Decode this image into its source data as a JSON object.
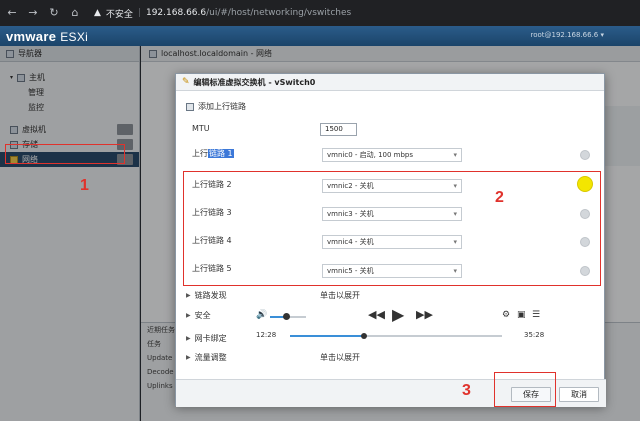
{
  "browser": {
    "security_label": "不安全",
    "host": "192.168.66.6",
    "path": "/ui/#/host/networking/vswitches"
  },
  "header": {
    "logo_brand": "vmware",
    "logo_product": "ESXi",
    "user": "root@192.168.66.6 ▾"
  },
  "sidebar": {
    "title": "导航器",
    "items": [
      {
        "label": "主机",
        "level": 0
      },
      {
        "label": "管理",
        "level": 1
      },
      {
        "label": "监控",
        "level": 1
      },
      {
        "label": "虚拟机",
        "level": 0
      },
      {
        "label": "存储",
        "level": 0
      },
      {
        "label": "网络",
        "level": 0,
        "selected": true
      }
    ]
  },
  "content": {
    "title": "localhost.localdomain - 网络",
    "bottom_rows": [
      "近期任务",
      "任务",
      "Update",
      "Decode",
      "Uplinks"
    ]
  },
  "modal": {
    "title": "编辑标准虚拟交换机 - vSwitch0",
    "add_uplink": "添加上行链路",
    "mtu_label": "MTU",
    "mtu_value": "1500",
    "uplinks": [
      {
        "label_prefix": "上行",
        "label_highlight": "链路 1",
        "value": "vmnic0 - 启动, 100 mbps"
      },
      {
        "label": "上行链路 2",
        "value": "vmnic2 - 关机"
      },
      {
        "label": "上行链路 3",
        "value": "vmnic3 - 关机"
      },
      {
        "label": "上行链路 4",
        "value": "vmnic4 - 关机"
      },
      {
        "label": "上行链路 5",
        "value": "vmnic5 - 关机"
      }
    ],
    "sections": [
      {
        "label": "链路发现",
        "value": "单击以展开"
      },
      {
        "label": "安全",
        "value": ""
      },
      {
        "label": "网卡绑定",
        "value": ""
      },
      {
        "label": "流量调整",
        "value": "单击以展开"
      }
    ],
    "save_label": "保存",
    "cancel_label": "取消"
  },
  "player": {
    "current_time": "12:28",
    "total_time": "35:28",
    "progress": 0.35,
    "volume": 0.45
  },
  "annotations": [
    "1",
    "2",
    "3"
  ],
  "colors": {
    "annotation_red": "#e0322c",
    "header_blue": "#1f4e79",
    "selection": "#2a4a6b",
    "hover_yellow": "#f3e600"
  }
}
